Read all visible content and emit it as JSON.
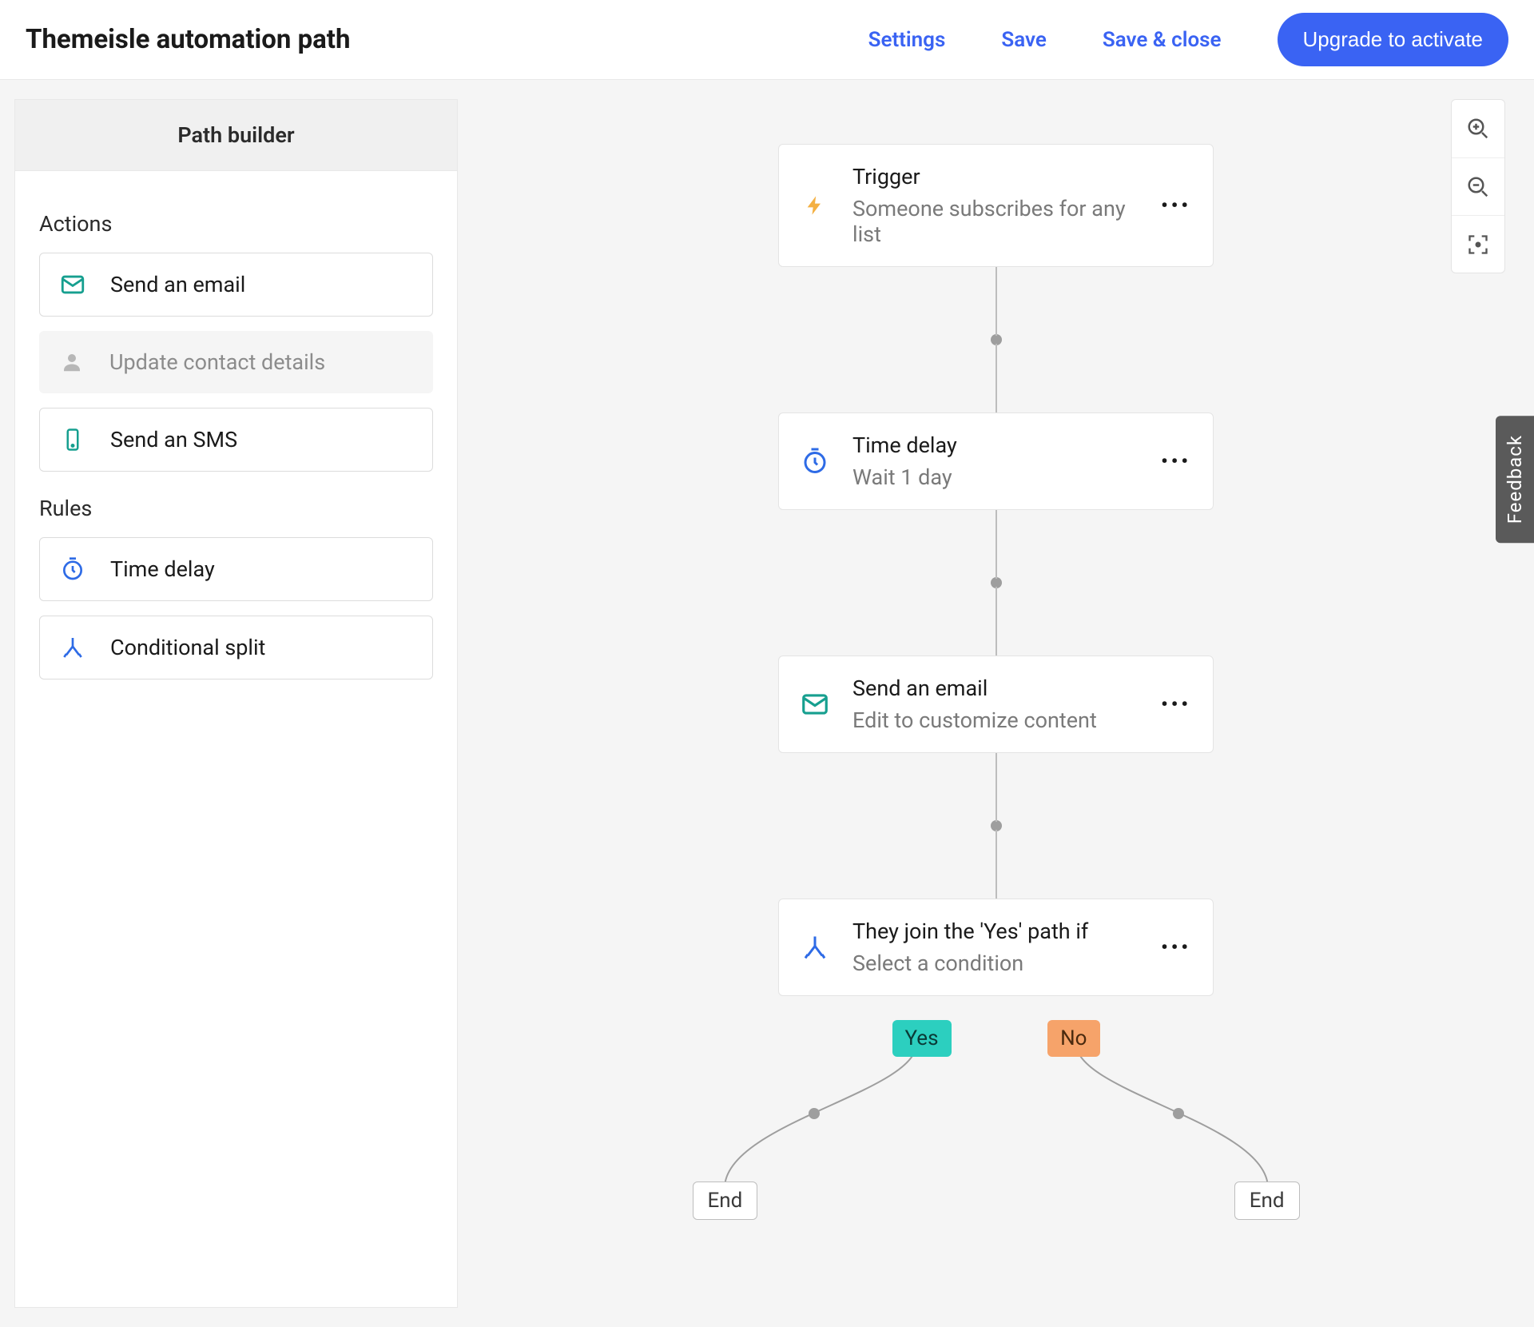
{
  "header": {
    "title": "Themeisle automation path",
    "links": {
      "settings": "Settings",
      "save": "Save",
      "save_close": "Save & close"
    },
    "cta": "Upgrade to activate"
  },
  "sidebar": {
    "title": "Path builder",
    "sections": {
      "actions_title": "Actions",
      "rules_title": "Rules"
    },
    "actions": [
      {
        "icon": "mail",
        "label": "Send an email",
        "enabled": true
      },
      {
        "icon": "person",
        "label": "Update contact details",
        "enabled": false
      },
      {
        "icon": "mobile",
        "label": "Send an SMS",
        "enabled": true
      }
    ],
    "rules": [
      {
        "icon": "timer",
        "label": "Time delay"
      },
      {
        "icon": "split",
        "label": "Conditional split"
      }
    ]
  },
  "flow": {
    "nodes": [
      {
        "icon": "bolt",
        "title": "Trigger",
        "sub": "Someone subscribes for any list"
      },
      {
        "icon": "timer",
        "title": "Time delay",
        "sub": "Wait 1 day"
      },
      {
        "icon": "mail",
        "title": "Send an email",
        "sub": "Edit to customize content"
      },
      {
        "icon": "split",
        "title": "They join the 'Yes' path if",
        "sub": "Select a condition"
      }
    ],
    "split": {
      "yes_label": "Yes",
      "no_label": "No",
      "end_label": "End"
    }
  },
  "feedback_label": "Feedback",
  "colors": {
    "accent": "#3a63f3",
    "teal": "#169f8f",
    "amber": "#f4b042",
    "blue": "#2e6be6",
    "split_blue": "#2e6be6",
    "yes_bg": "#2ccfbf",
    "no_bg": "#f6a36a"
  }
}
